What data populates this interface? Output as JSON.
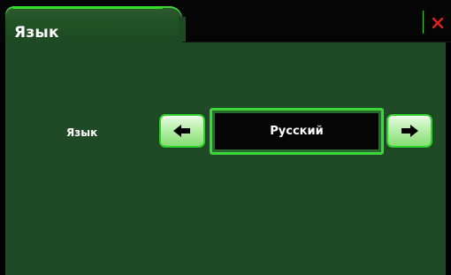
{
  "header": {
    "title": "Язык"
  },
  "language_setting": {
    "label": "Язык",
    "value": "Русский"
  },
  "icons": {
    "close": "close-icon",
    "prev": "arrow-left-icon",
    "next": "arrow-right-icon"
  },
  "colors": {
    "accent_green": "#2bd227",
    "panel": "#1f4a25",
    "close_red": "#e0201c"
  }
}
